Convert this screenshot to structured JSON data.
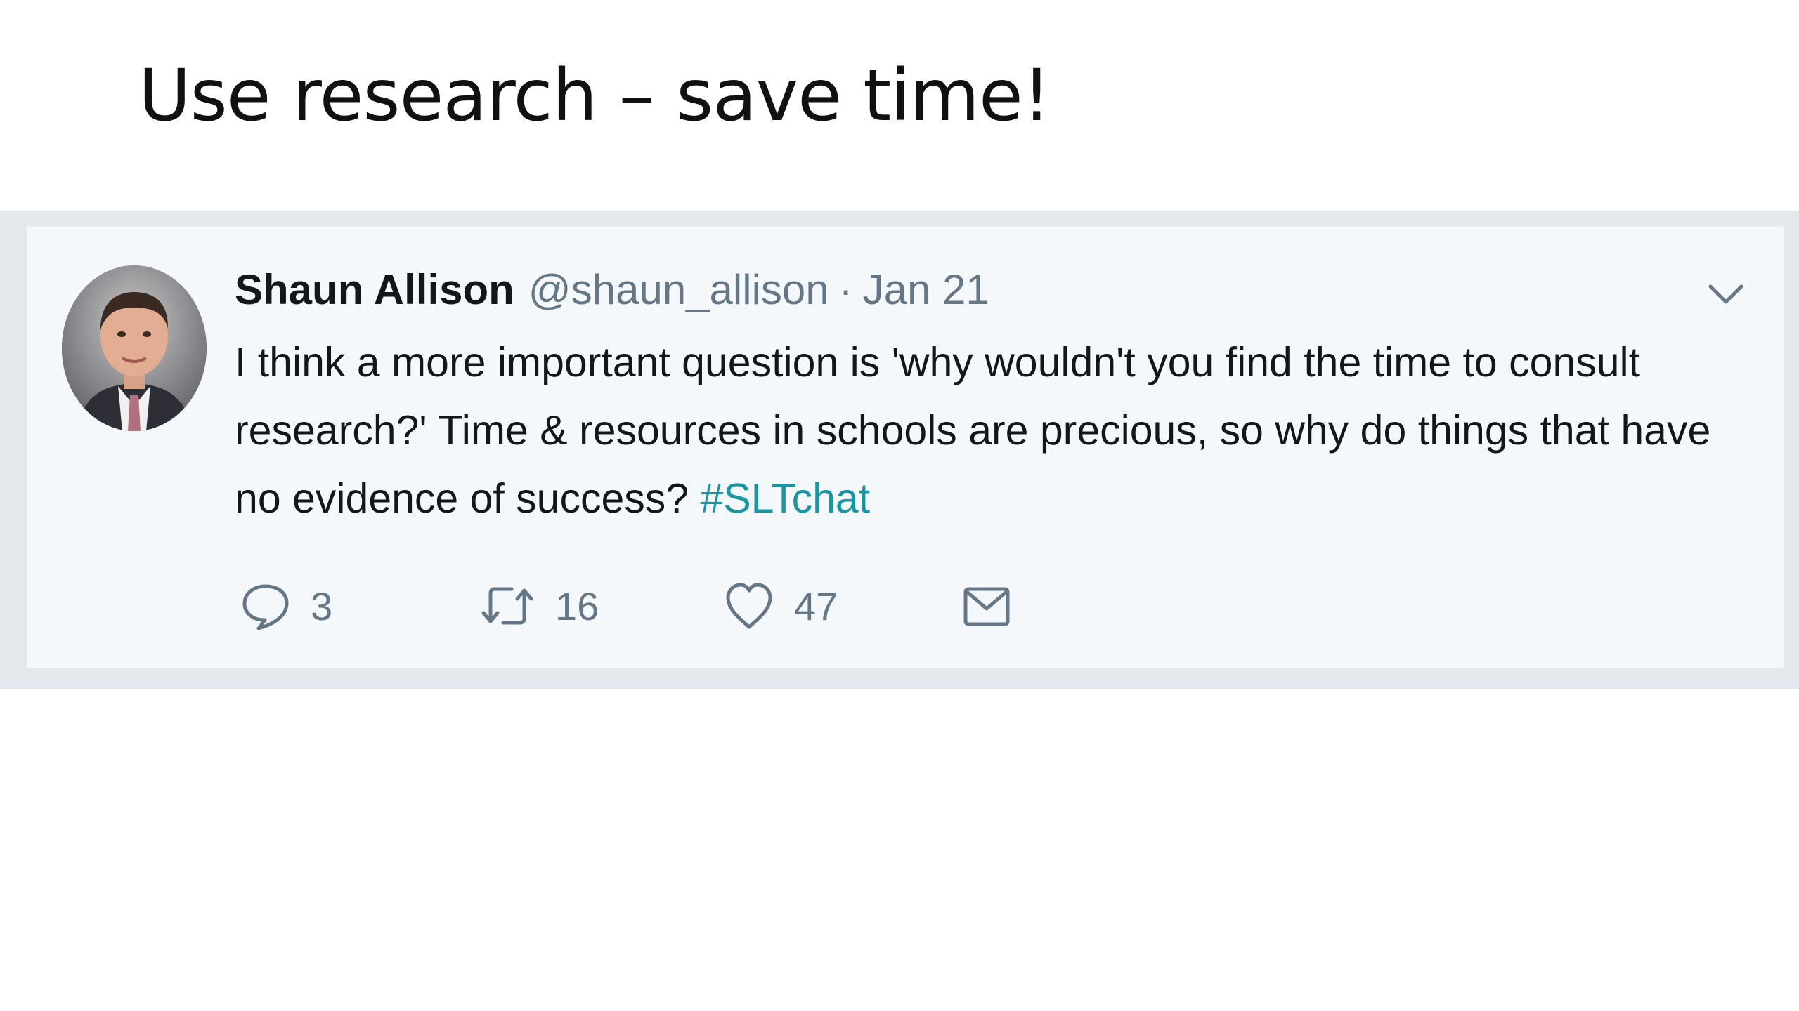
{
  "slide": {
    "title": "Use research – save time!"
  },
  "tweet": {
    "author_name": "Shaun Allison",
    "author_handle": "@shaun_allison",
    "separator": "·",
    "date": "Jan 21",
    "text": "I think a more important question is 'why wouldn't you find the time to consult research?'  Time & resources in schools are precious, so why do things that have no evidence of success? ",
    "hashtag": "#SLTchat",
    "hashtag_color": "#1b95a0",
    "actions": {
      "reply": {
        "icon": "reply-icon",
        "count": "3"
      },
      "retweet": {
        "icon": "retweet-icon",
        "count": "16"
      },
      "like": {
        "icon": "heart-icon",
        "count": "47"
      },
      "message": {
        "icon": "envelope-icon"
      }
    },
    "menu_icon": "chevron-down-icon"
  },
  "colors": {
    "text": "#14171a",
    "secondary": "#657786",
    "card_background": "#f5f8fa",
    "frame": "#e3e8ed"
  }
}
